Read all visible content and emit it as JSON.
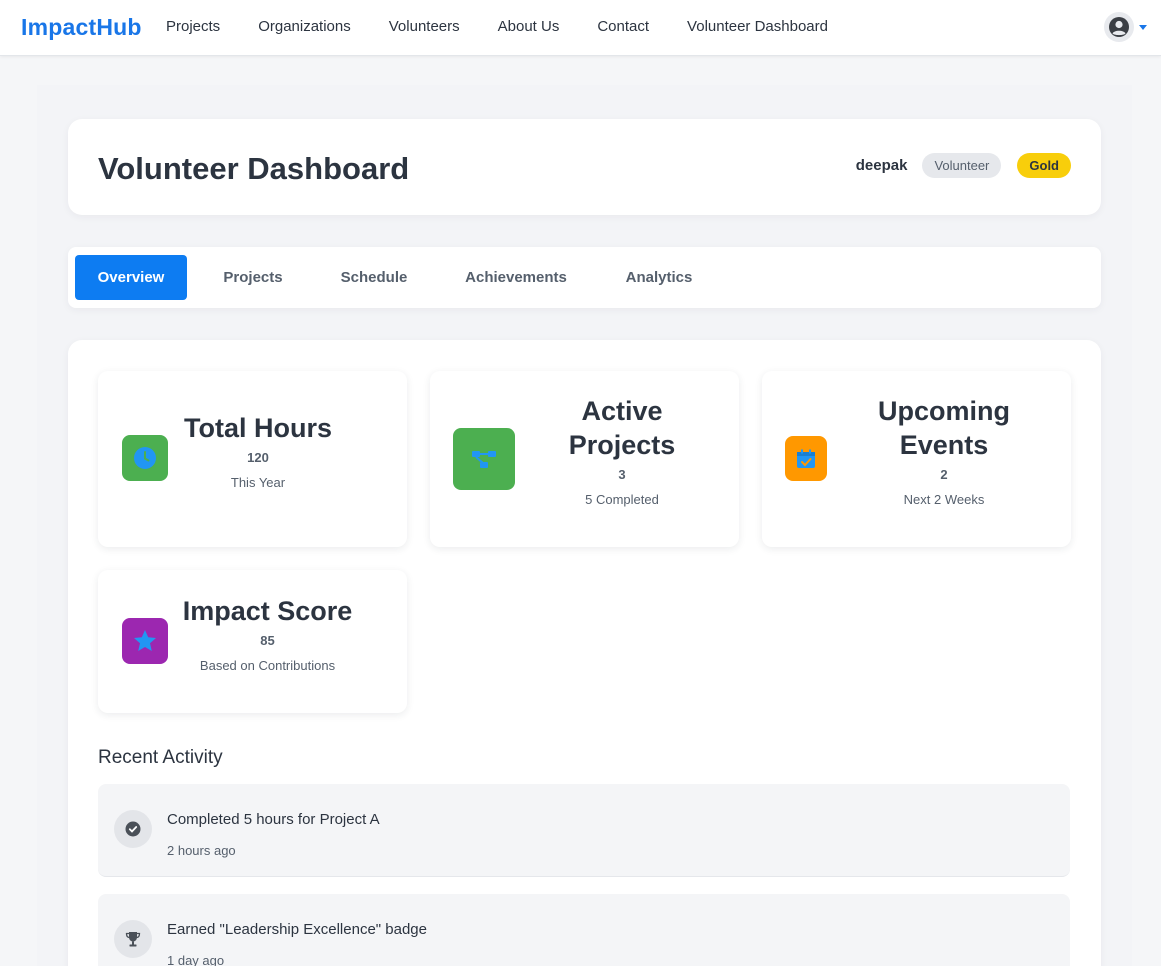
{
  "navbar": {
    "brand": "ImpactHub",
    "links": [
      "Projects",
      "Organizations",
      "Volunteers",
      "About Us",
      "Contact",
      "Volunteer Dashboard"
    ]
  },
  "header": {
    "title": "Volunteer Dashboard",
    "username": "deepak",
    "role": "Volunteer",
    "level": "Gold"
  },
  "tabs": [
    "Overview",
    "Projects",
    "Schedule",
    "Achievements",
    "Analytics"
  ],
  "active_tab": "Overview",
  "stats": [
    {
      "title": "Total Hours",
      "value": "120",
      "sub": "This Year",
      "icon": "clock-icon",
      "color": "#4caf50"
    },
    {
      "title": "Active Projects",
      "value": "3",
      "sub": "5 Completed",
      "icon": "project-diagram-icon",
      "color": "#4caf50"
    },
    {
      "title": "Upcoming Events",
      "value": "2",
      "sub": "Next 2 Weeks",
      "icon": "calendar-check-icon",
      "color": "#ff9800"
    },
    {
      "title": "Impact Score",
      "value": "85",
      "sub": "Based on Contributions",
      "icon": "star-icon",
      "color": "#9c27b0"
    }
  ],
  "recent_activity": {
    "title": "Recent Activity",
    "items": [
      {
        "text": "Completed 5 hours for Project A",
        "time": "2 hours ago",
        "icon": "check-circle-icon"
      },
      {
        "text": "Earned \"Leadership Excellence\" badge",
        "time": "1 day ago",
        "icon": "trophy-icon"
      }
    ]
  },
  "colors": {
    "primary": "#1976e8",
    "active_tab": "#0d7cf2",
    "gold_badge": "#f8ce0b",
    "icon_glyph": "#2196f3"
  }
}
